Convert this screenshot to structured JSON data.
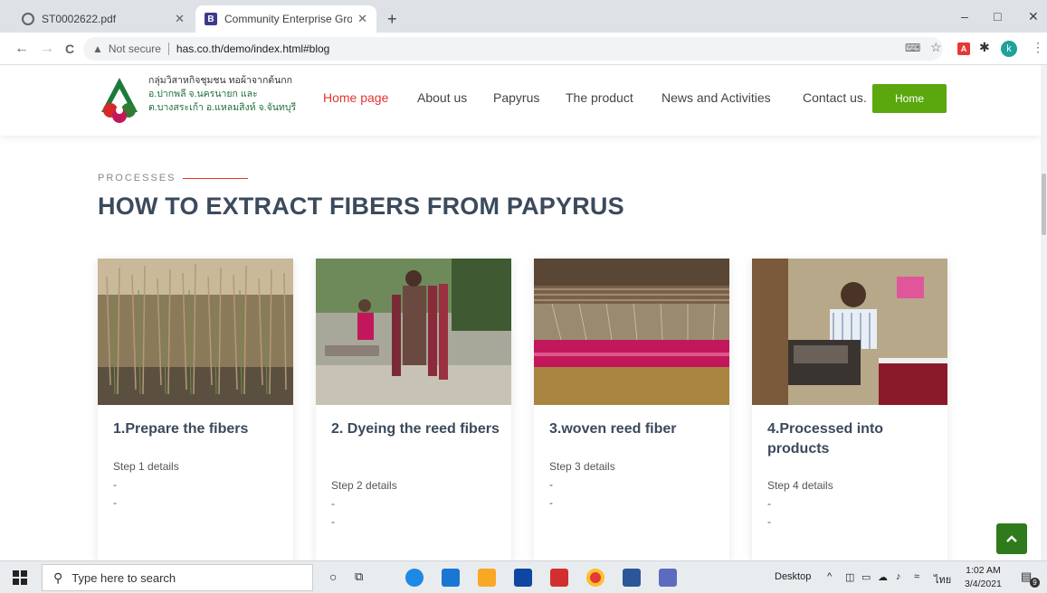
{
  "browser": {
    "tabs": [
      {
        "title": "ST0002622.pdf",
        "icon": "globe-icon"
      },
      {
        "title": "Community Enterprise Group We",
        "icon": "site-favicon",
        "favicon_letter": "B"
      }
    ],
    "new_tab": "+",
    "controls": {
      "minimize": "–",
      "maximize": "□",
      "close": "✕"
    },
    "nav": {
      "back": "←",
      "forward": "→",
      "reload": "C"
    },
    "security_label": "Not secure",
    "url": "has.co.th/demo/index.html#blog",
    "avatar_letter": "k",
    "pdf_ext_label": "A"
  },
  "site": {
    "logo_lines": [
      "กลุ่มวิสาหกิจชุมชน ทอผ้าจากต้นกก",
      "อ.ปากพลี จ.นครนายก และ",
      "ต.บางสระเก้า อ.แหลมสิงห์ จ.จันทบุรี"
    ],
    "nav": [
      "Home page",
      "About us",
      "Papyrus",
      "The product",
      "News and Activities",
      "Contact us."
    ],
    "home_button": "Home",
    "accent": "#e2362e",
    "green": "#5aa70e"
  },
  "section": {
    "eyebrow": "PROCESSES",
    "title": "HOW TO EXTRACT FIBERS FROM PAPYRUS"
  },
  "cards": [
    {
      "title": "1.Prepare the fibers",
      "detail": "Step 1 details",
      "bullets": [
        "-",
        "-"
      ]
    },
    {
      "title": "2. Dyeing the reed fibers",
      "detail": "Step 2 details",
      "bullets": [
        "-",
        "-"
      ]
    },
    {
      "title": "3.woven reed fiber",
      "detail": "Step 3 details",
      "bullets": [
        "-",
        "-"
      ]
    },
    {
      "title": "4.Processed into products",
      "detail": "Step 4 details",
      "bullets": [
        "-",
        "-"
      ]
    }
  ],
  "back_to_top": "^",
  "taskbar": {
    "search_placeholder": "Type here to search",
    "desktop_label": "Desktop",
    "lang": "ไทย",
    "time": "1:02 AM",
    "date": "3/4/2021",
    "notification_count": "9"
  }
}
